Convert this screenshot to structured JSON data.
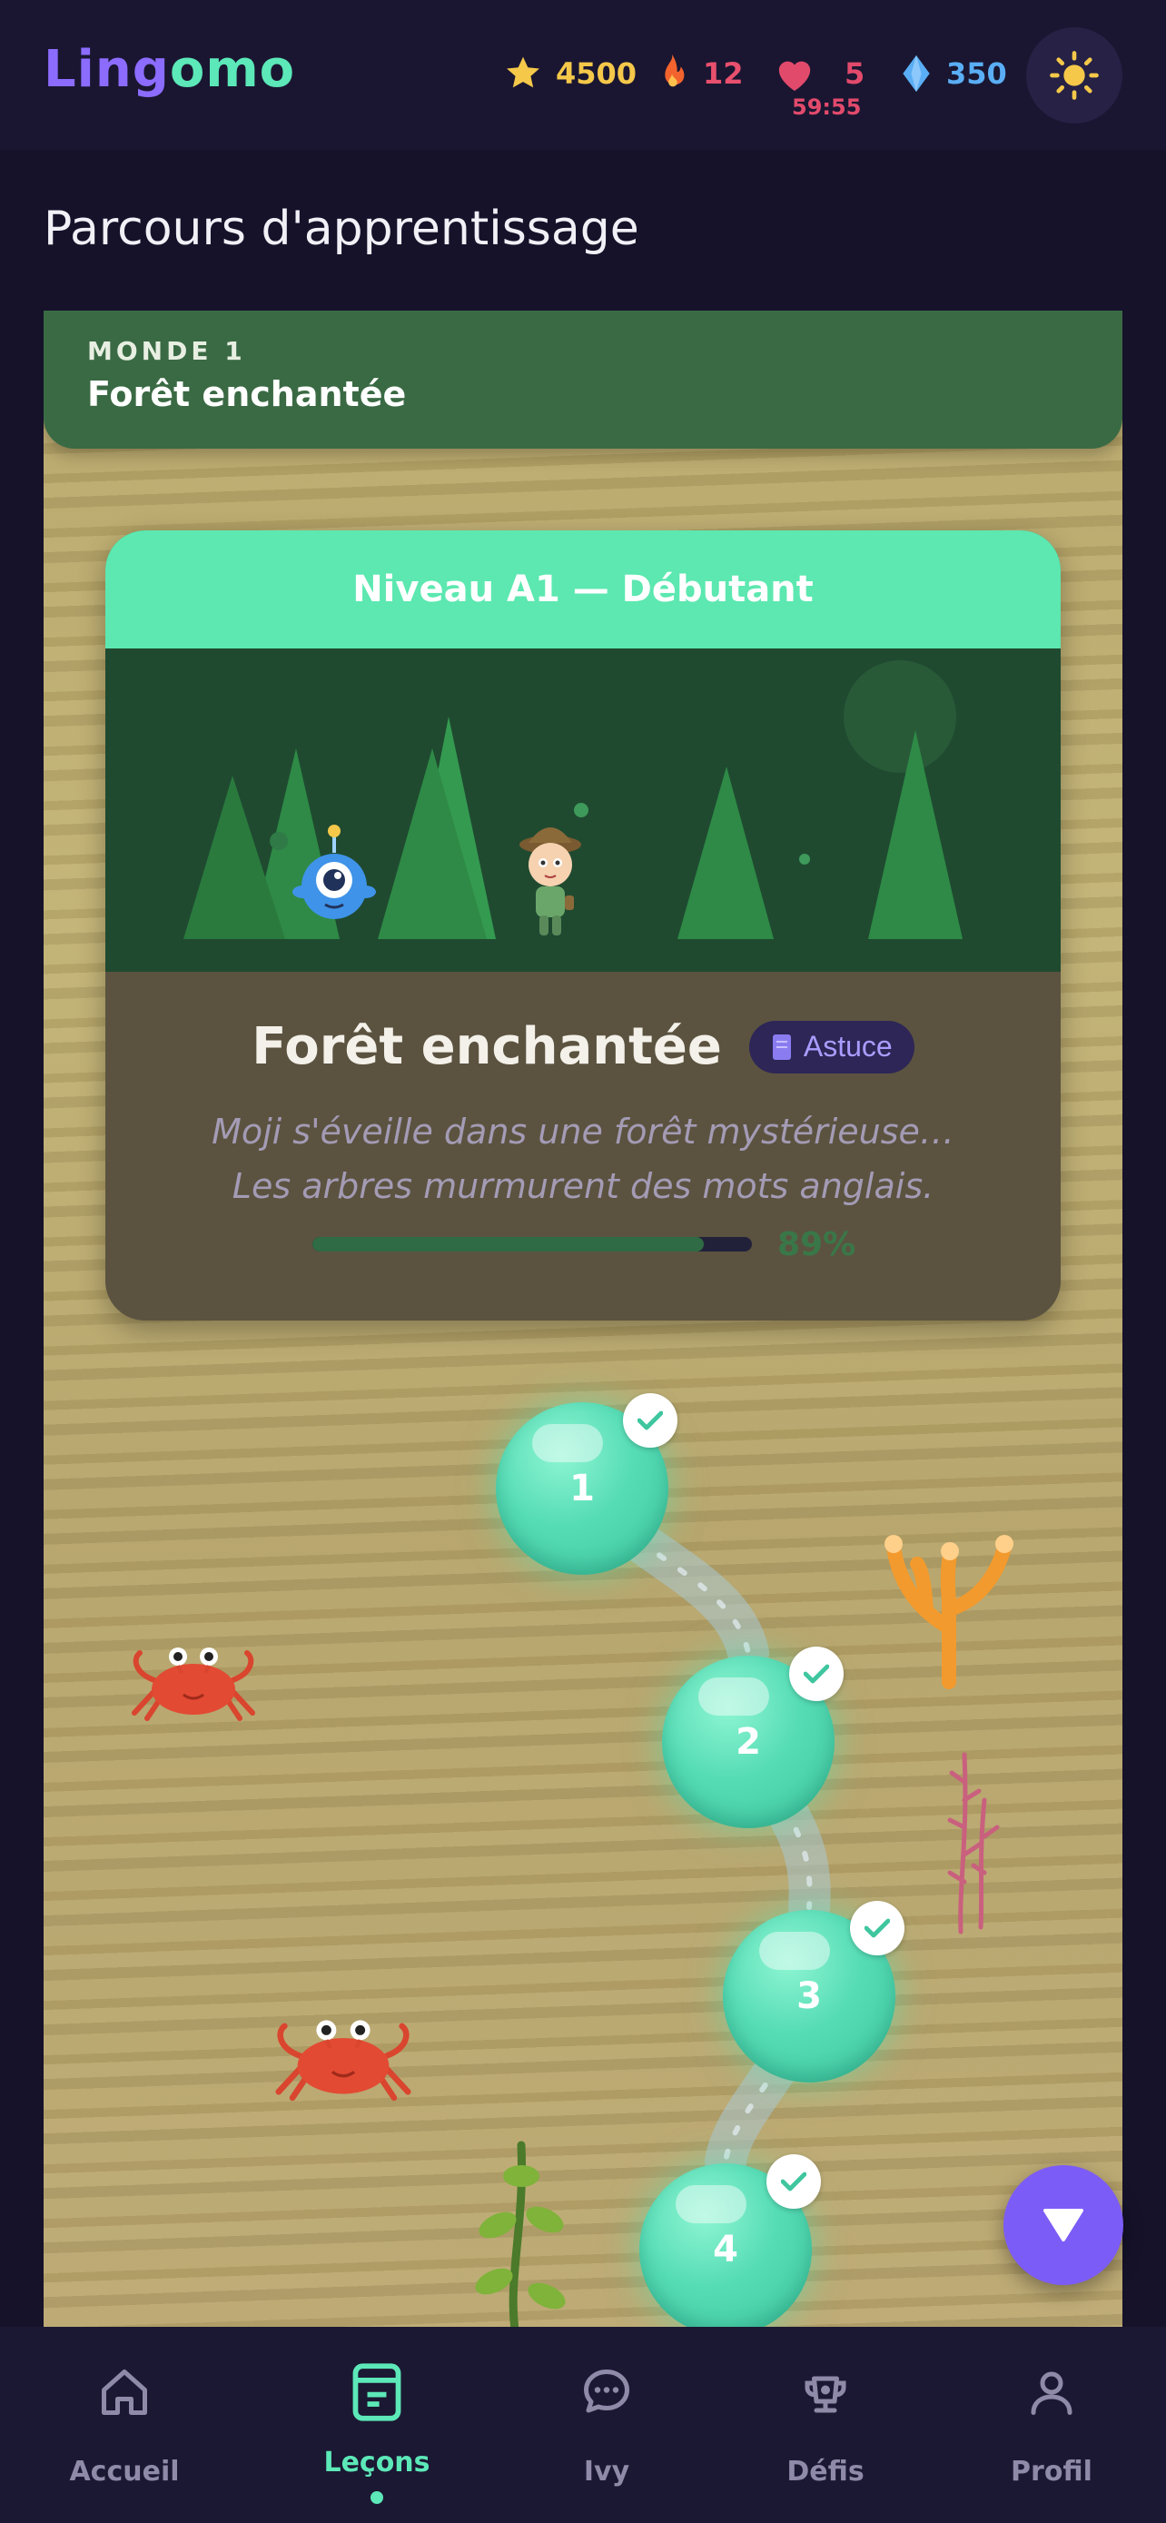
{
  "header": {
    "logo_part1": "Ling",
    "logo_part2": "omo",
    "stats": {
      "stars": "4500",
      "streak": "12",
      "hearts": "5",
      "hearts_timer": "59:55",
      "gems": "350"
    },
    "theme_icon": "sun-icon"
  },
  "page_title": "Parcours d'apprentissage",
  "world": {
    "kicker": "MONDE 1",
    "name": "Forêt enchantée"
  },
  "level_card": {
    "band_label": "Niveau A1 — Débutant",
    "title": "Forêt enchantée",
    "tip_label": "Astuce",
    "description": "Moji s'éveille dans une forêt mystérieuse… Les arbres murmurent des mots anglais.",
    "progress_percent": 89,
    "progress_label": "89%"
  },
  "lessons": [
    {
      "number": "1",
      "completed": true
    },
    {
      "number": "2",
      "completed": true
    },
    {
      "number": "3",
      "completed": true
    },
    {
      "number": "4",
      "completed": true
    }
  ],
  "fab_icon": "triangle-down-icon",
  "bottom_nav": {
    "items": [
      {
        "label": "Accueil",
        "icon": "home-icon",
        "active": false
      },
      {
        "label": "Leçons",
        "icon": "lessons-icon",
        "active": true
      },
      {
        "label": "Ivy",
        "icon": "chat-bubble-icon",
        "active": false
      },
      {
        "label": "Défis",
        "icon": "challenge-icon",
        "active": false
      },
      {
        "label": "Profil",
        "icon": "profile-icon",
        "active": false
      }
    ]
  },
  "colors": {
    "accent_green": "#5ce8b8",
    "accent_purple": "#7c5cf6",
    "heart_red": "#e24a6c",
    "star_yellow": "#f5c84a",
    "gem_blue": "#5aaef5",
    "background": "#15122a"
  }
}
